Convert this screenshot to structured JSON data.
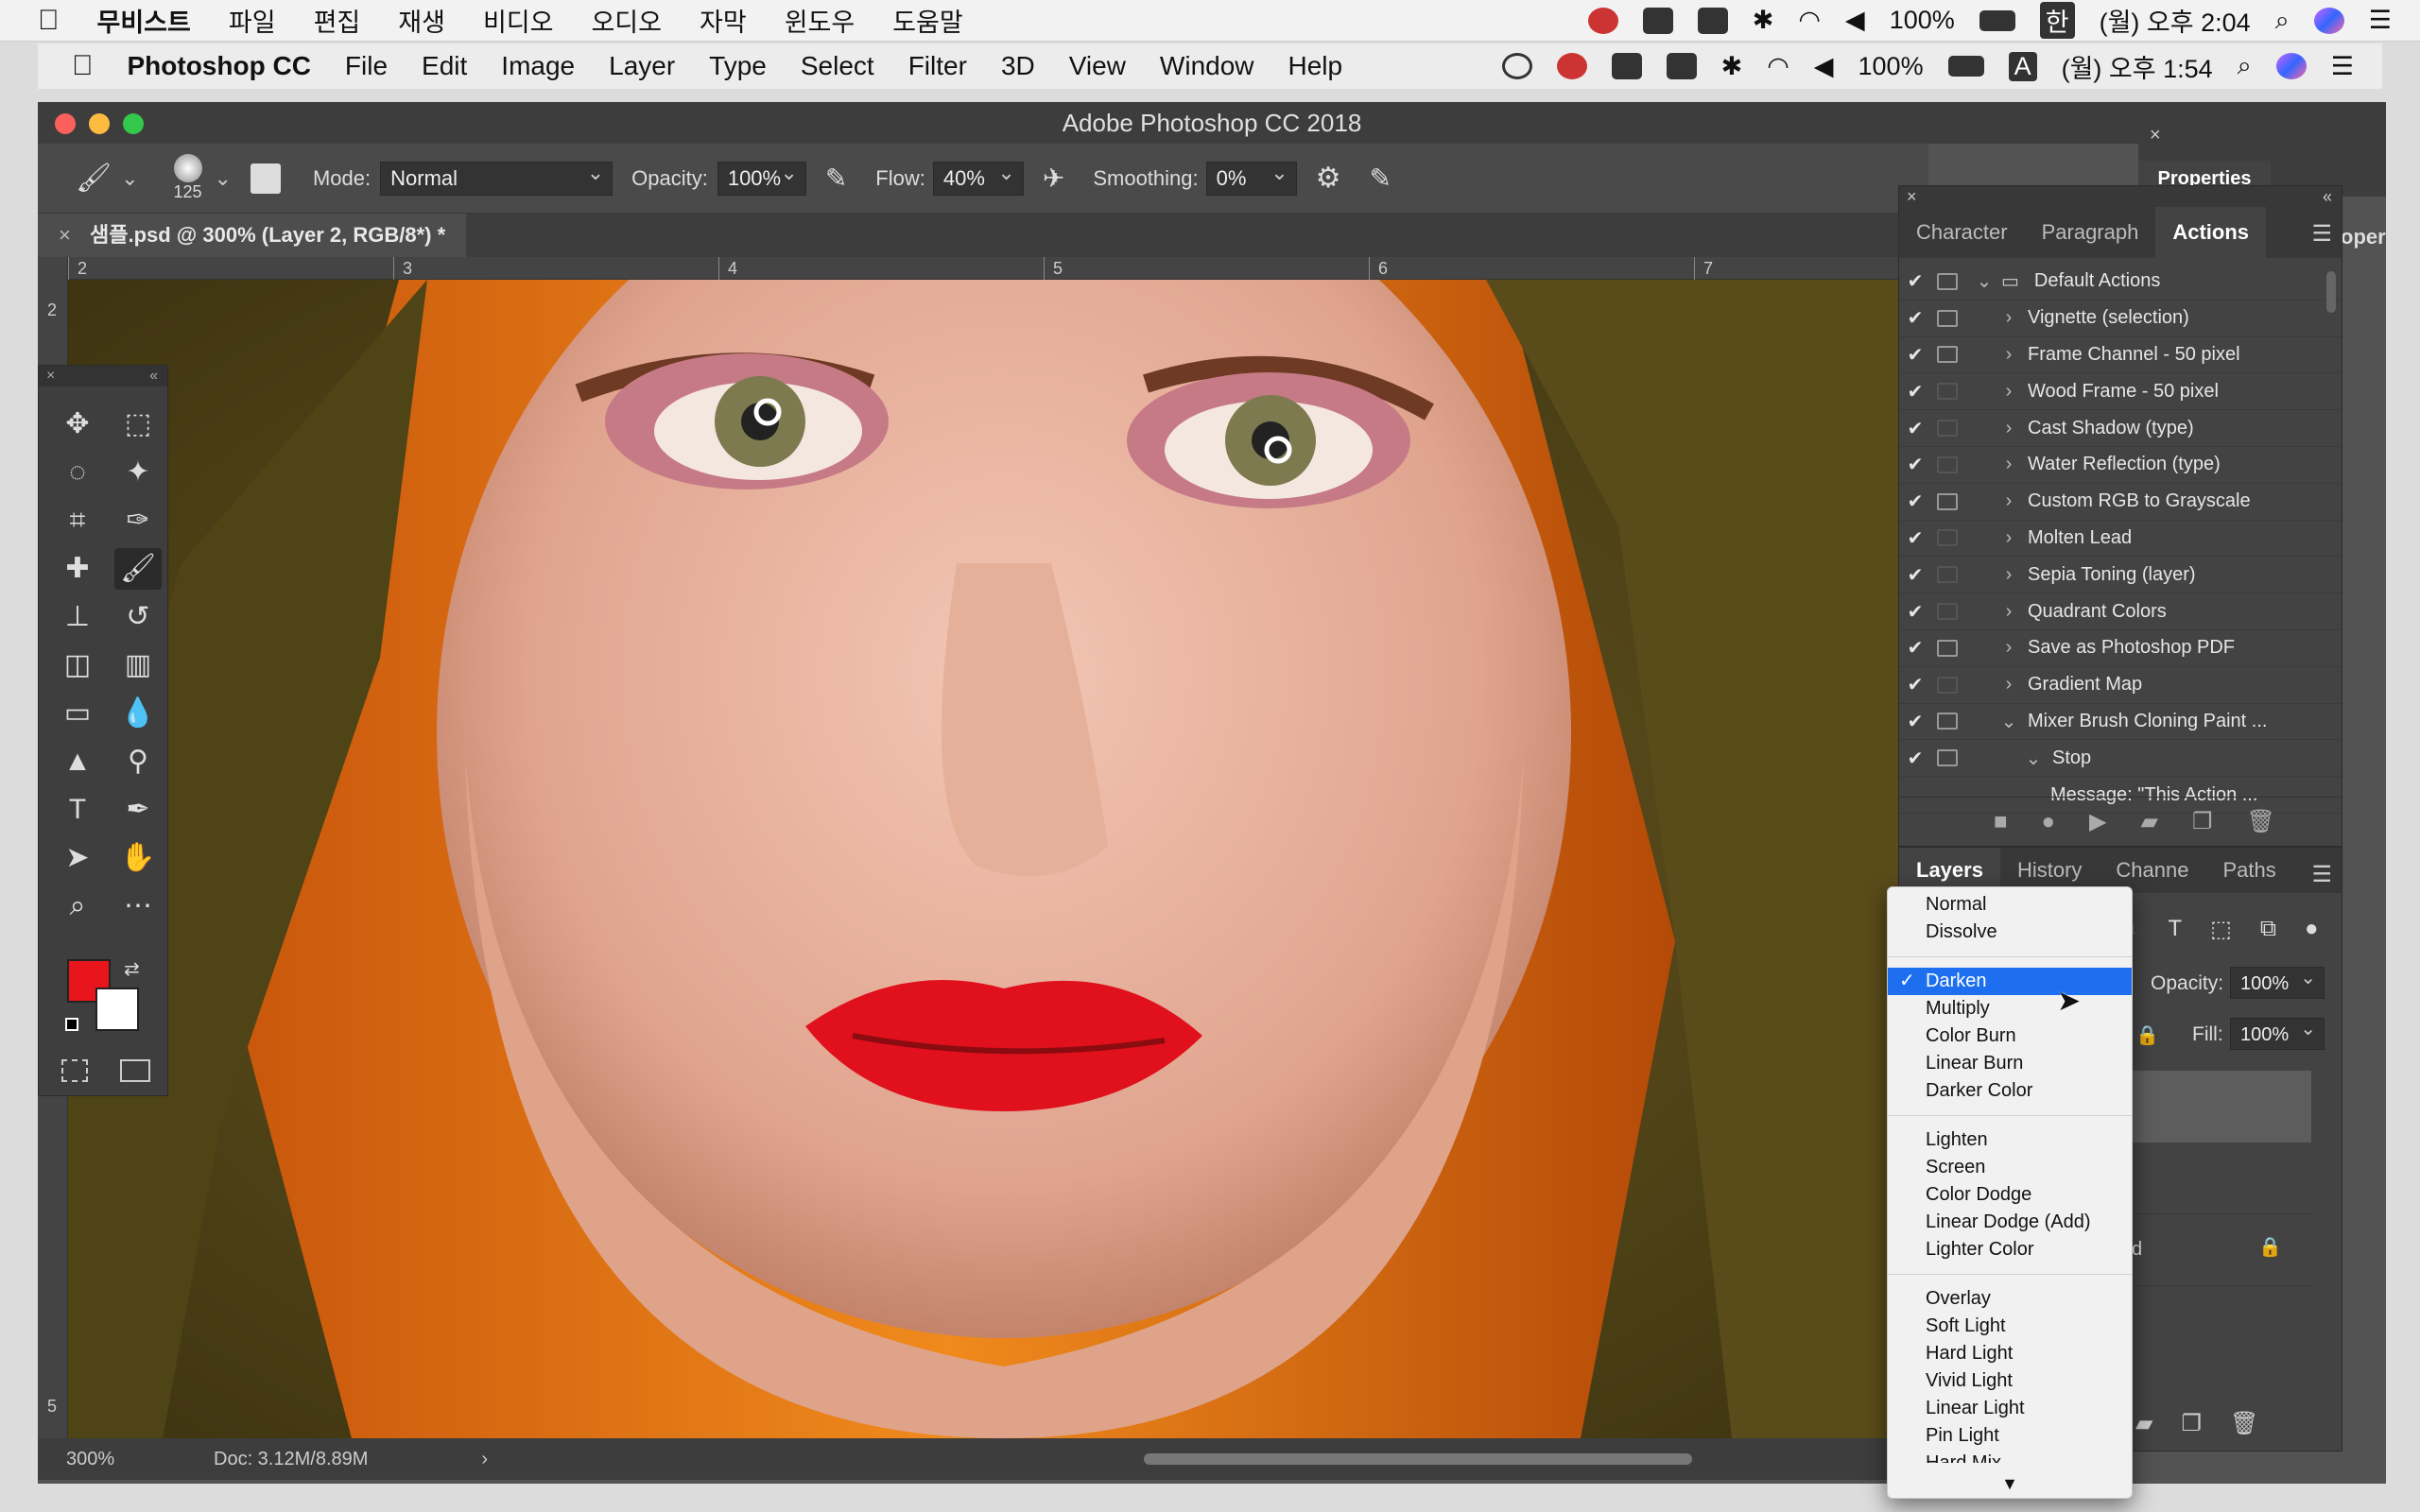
{
  "outer_menubar": {
    "app": "무비스트",
    "items": [
      "파일",
      "편집",
      "재생",
      "비디오",
      "오디오",
      "자막",
      "윈도우",
      "도움말"
    ],
    "battery": "100%",
    "input": "한",
    "clock": "(월) 오후 2:04"
  },
  "inner_menubar": {
    "app": "Photoshop CC",
    "items": [
      "File",
      "Edit",
      "Image",
      "Layer",
      "Type",
      "Select",
      "Filter",
      "3D",
      "View",
      "Window",
      "Help"
    ],
    "battery": "100%",
    "input": "A",
    "clock": "(월) 오후 1:54"
  },
  "window": {
    "title": "Adobe Photoshop CC 2018"
  },
  "options_bar": {
    "brush_size": "125",
    "mode_label": "Mode:",
    "mode_value": "Normal",
    "opacity_label": "Opacity:",
    "opacity_value": "100%",
    "flow_label": "Flow:",
    "flow_value": "40%",
    "smoothing_label": "Smoothing:",
    "smoothing_value": "0%"
  },
  "document": {
    "tab_title": "샘플.psd @ 300% (Layer 2, RGB/8*) *",
    "zoom": "300%",
    "doc_info": "Doc: 3.12M/8.89M",
    "ruler_h": [
      "2",
      "3",
      "4",
      "5",
      "6",
      "7"
    ],
    "ruler_v": [
      "2",
      "5"
    ]
  },
  "colors": {
    "foreground": "#e8161c",
    "background": "#ffffff",
    "highlight": "#1e6ff0"
  },
  "properties_panel": {
    "title": "Properties",
    "tab_fragment": "oper"
  },
  "actions_panel": {
    "tabs": [
      "Character",
      "Paragraph",
      "Actions"
    ],
    "active_tab": "Actions",
    "rows": [
      {
        "label": "Default Actions",
        "dialog": true,
        "expanded": true,
        "indent": 0,
        "folder": true
      },
      {
        "label": "Vignette (selection)",
        "dialog": true,
        "indent": 1
      },
      {
        "label": "Frame Channel - 50 pixel",
        "dialog": true,
        "indent": 1
      },
      {
        "label": "Wood Frame - 50 pixel",
        "dialog": false,
        "indent": 1
      },
      {
        "label": "Cast Shadow (type)",
        "dialog": false,
        "indent": 1
      },
      {
        "label": "Water Reflection (type)",
        "dialog": false,
        "indent": 1
      },
      {
        "label": "Custom RGB to Grayscale",
        "dialog": true,
        "indent": 1
      },
      {
        "label": "Molten Lead",
        "dialog": false,
        "indent": 1
      },
      {
        "label": "Sepia Toning (layer)",
        "dialog": false,
        "indent": 1
      },
      {
        "label": "Quadrant Colors",
        "dialog": false,
        "indent": 1
      },
      {
        "label": "Save as Photoshop PDF",
        "dialog": true,
        "indent": 1
      },
      {
        "label": "Gradient Map",
        "dialog": false,
        "indent": 1
      },
      {
        "label": "Mixer Brush Cloning Paint ...",
        "dialog": true,
        "expanded": true,
        "indent": 1
      },
      {
        "label": "Stop",
        "dialog": true,
        "expanded": true,
        "indent": 2
      },
      {
        "label": "Message: \"This Action ...",
        "dialog": false,
        "indent": 3,
        "nocheck": true
      }
    ]
  },
  "layers_panel": {
    "tabs": [
      "Layers",
      "History",
      "Channe",
      "Paths"
    ],
    "opacity_label": "Opacity:",
    "opacity_value": "100%",
    "fill_label": "Fill:",
    "fill_value": "100%",
    "lock_fragment": "d"
  },
  "blend_menu": {
    "groups": [
      [
        "Normal",
        "Dissolve"
      ],
      [
        "Darken",
        "Multiply",
        "Color Burn",
        "Linear Burn",
        "Darker Color"
      ],
      [
        "Lighten",
        "Screen",
        "Color Dodge",
        "Linear Dodge (Add)",
        "Lighter Color"
      ],
      [
        "Overlay",
        "Soft Light",
        "Hard Light",
        "Vivid Light",
        "Linear Light",
        "Pin Light",
        "Hard Mix"
      ]
    ],
    "selected": "Darken"
  }
}
